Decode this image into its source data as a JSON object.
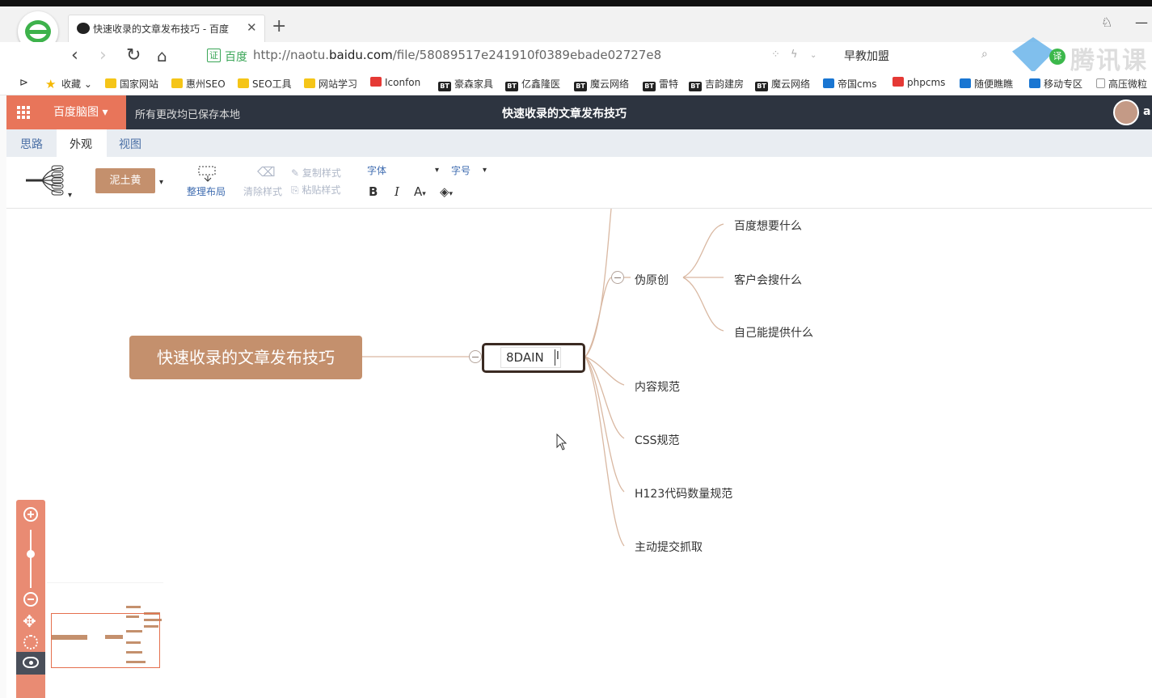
{
  "browser": {
    "tab_title": "快速收录的文章发布技巧 - 百度",
    "tab_close": "✕",
    "new_tab": "+",
    "url_badge": "证",
    "url_site": "百度",
    "url_prefix": "http://naotu.",
    "url_domain": "baidu.com",
    "url_path": "/file/58089517e241910f0389ebade02727e8",
    "search_text": "早教加盟",
    "watermark_text": "腾讯课",
    "watermark_badge": "译"
  },
  "bookmarks": [
    {
      "label": "收藏",
      "icon": "star"
    },
    {
      "label": "国家网站",
      "icon": "folder"
    },
    {
      "label": "惠州SEO",
      "icon": "folder"
    },
    {
      "label": "SEO工具",
      "icon": "folder"
    },
    {
      "label": "网站学习",
      "icon": "folder"
    },
    {
      "label": "Iconfon",
      "icon": "red"
    },
    {
      "label": "豪森家具",
      "icon": "bt"
    },
    {
      "label": "亿鑫隆医",
      "icon": "bt"
    },
    {
      "label": "魔云网络",
      "icon": "bt"
    },
    {
      "label": "雷特",
      "icon": "bt"
    },
    {
      "label": "吉韵建房",
      "icon": "bt"
    },
    {
      "label": "魔云网络",
      "icon": "bt"
    },
    {
      "label": "帝国cms",
      "icon": "blue"
    },
    {
      "label": "phpcms",
      "icon": "red"
    },
    {
      "label": "随便瞧瞧",
      "icon": "blue"
    },
    {
      "label": "移动专区",
      "icon": "blue"
    },
    {
      "label": "高压微粒",
      "icon": "page"
    }
  ],
  "app": {
    "brand": "百度脑图",
    "saved_status": "所有更改均已保存本地",
    "doc_title": "快速收录的文章发布技巧",
    "user_initial": "a"
  },
  "menu_tabs": [
    "思路",
    "外观",
    "视图"
  ],
  "toolbar": {
    "theme": "泥土黄",
    "arrange": "整理布局",
    "clear_style": "清除样式",
    "copy_style": "复制样式",
    "paste_style": "粘贴样式",
    "font": "字体",
    "font_size": "字号",
    "bold": "B",
    "italic": "I",
    "font_color": "A"
  },
  "mindmap": {
    "root": "快速收录的文章发布技巧",
    "editing_value": "8DAIN",
    "editing_suffix": "I",
    "branches": [
      "伪原创",
      "内容规范",
      "CSS规范",
      "H123代码数量规范",
      "主动提交抓取"
    ],
    "sub_branches": [
      "百度想要什么",
      "客户会搜什么",
      "自己能提供什么"
    ]
  },
  "colors": {
    "accent": "#e8755a",
    "header": "#2d3440",
    "theme": "#c4906d",
    "link": "#c9a48c"
  }
}
